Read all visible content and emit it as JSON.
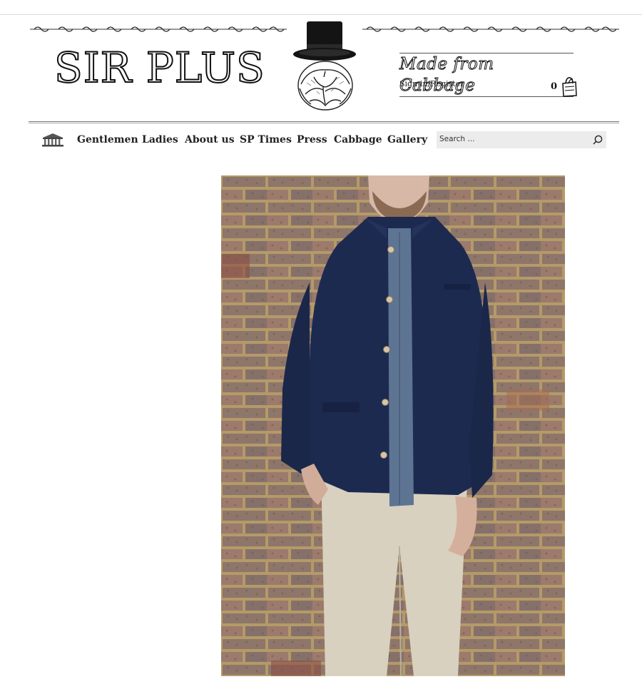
{
  "brand": {
    "logo_text": "SIR PLUS",
    "tagline": "Made from Cabbage",
    "signin_label": "Sign-in/Register",
    "cart_count": "0"
  },
  "nav": {
    "items": [
      {
        "label": "Gentlemen"
      },
      {
        "label": "Ladies"
      },
      {
        "label": "About us"
      },
      {
        "label": "SP Times"
      },
      {
        "label": "Press"
      },
      {
        "label": "Cabbage"
      },
      {
        "label": "Gallery"
      }
    ],
    "search_placeholder": "Search ..."
  },
  "icons": {
    "home": "building-icon",
    "cart": "shopping-bag-icon",
    "search": "search-icon",
    "mascot": "top-hat-cabbage-icon"
  },
  "colors": {
    "jacket": "#1d2a4f",
    "shirt": "#5d7492",
    "trousers": "#d9d3c4",
    "brick": "#9a7e6c",
    "mortar": "#b8a070"
  }
}
